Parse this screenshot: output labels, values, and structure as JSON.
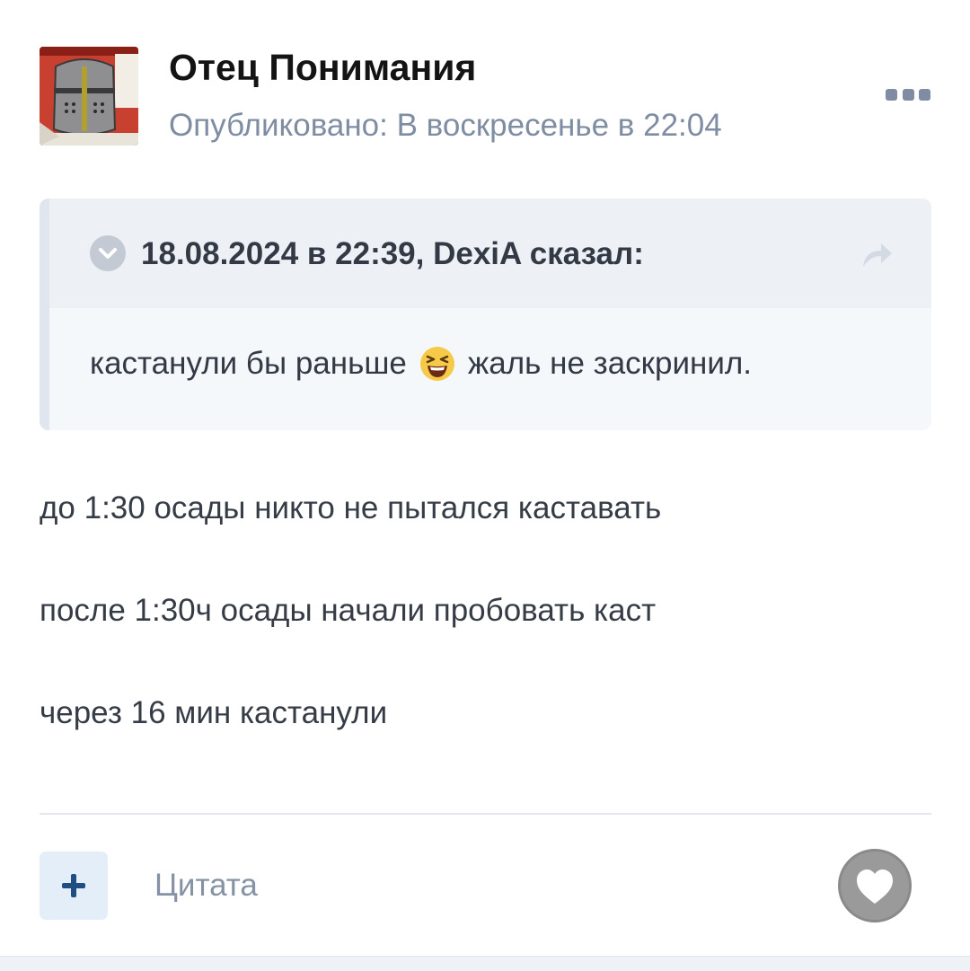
{
  "post": {
    "author": "Отец Понимания",
    "published": "Опубликовано: В воскресенье в 22:04",
    "avatar_icon": "knight-helmet-avatar",
    "more_icon": "more-dots-icon"
  },
  "quote": {
    "attribution": "18.08.2024 в 22:39, DexiA сказал:",
    "text_before": "кастанули бы раньше",
    "emoji": "😆",
    "text_after": "жаль не заскринил.",
    "expand_icon": "chevron-down-icon",
    "share_icon": "share-arrow-icon"
  },
  "body": {
    "lines": [
      "до 1:30 осады никто не пытался каставать",
      "после 1:30ч осады начали пробовать каст",
      "через 16 мин кастанули"
    ]
  },
  "footer": {
    "add_icon": "plus-icon",
    "quote_label": "Цитата",
    "like_icon": "heart-icon"
  },
  "colors": {
    "meta_text": "#7f8da3",
    "quote_bg": "#f4f8fb",
    "quote_head_bg": "#edf1f6",
    "accent_button_bg": "#e4eef9",
    "accent_plus": "#1f4f82",
    "like_bg": "#9a9a9a"
  }
}
